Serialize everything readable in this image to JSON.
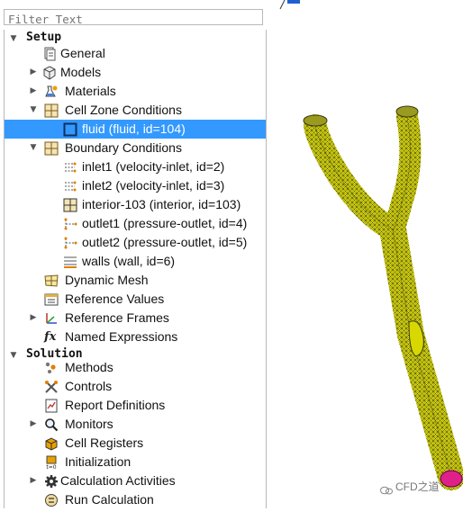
{
  "filter": {
    "placeholder": "Filter Text"
  },
  "tree": {
    "setup_label": "Setup",
    "general": "General",
    "models": "Models",
    "materials": "Materials",
    "cell_zone_conditions": "Cell Zone Conditions",
    "fluid": "fluid (fluid, id=104)",
    "boundary_conditions": "Boundary Conditions",
    "inlet1": "inlet1 (velocity-inlet, id=2)",
    "inlet2": "inlet2 (velocity-inlet, id=3)",
    "interior": "interior-103 (interior, id=103)",
    "outlet1": "outlet1 (pressure-outlet, id=4)",
    "outlet2": "outlet2 (pressure-outlet, id=5)",
    "walls": "walls (wall, id=6)",
    "dynamic_mesh": "Dynamic Mesh",
    "reference_values": "Reference Values",
    "reference_frames": "Reference Frames",
    "named_expressions": "Named Expressions",
    "solution_label": "Solution",
    "methods": "Methods",
    "controls": "Controls",
    "report_definitions": "Report Definitions",
    "monitors": "Monitors",
    "cell_registers": "Cell Registers",
    "initialization": "Initialization",
    "calculation_activities": "Calculation Activities",
    "run_calculation": "Run Calculation"
  },
  "watermark": "CFD之道",
  "colors": {
    "selection": "#3399ff",
    "mesh": "#d8d800",
    "mesh_lines": "#4a4a10"
  }
}
